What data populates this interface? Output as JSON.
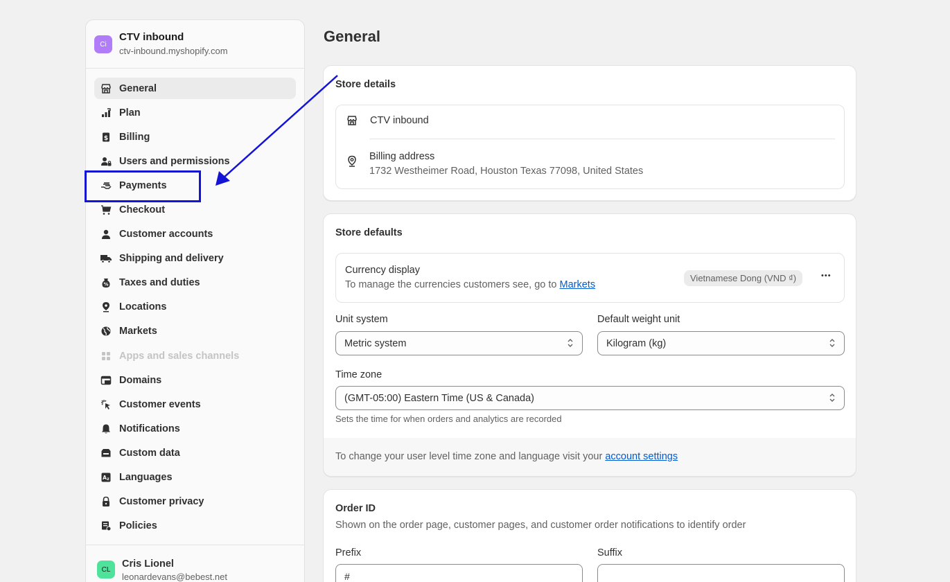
{
  "store": {
    "initials": "Ci",
    "name": "CTV inbound",
    "domain": "ctv-inbound.myshopify.com"
  },
  "nav": {
    "items": [
      {
        "label": "General",
        "icon": "store-icon",
        "active": true
      },
      {
        "label": "Plan",
        "icon": "plan-icon"
      },
      {
        "label": "Billing",
        "icon": "billing-icon"
      },
      {
        "label": "Users and permissions",
        "icon": "users-icon"
      },
      {
        "label": "Payments",
        "icon": "payments-icon"
      },
      {
        "label": "Checkout",
        "icon": "cart-icon"
      },
      {
        "label": "Customer accounts",
        "icon": "person-icon"
      },
      {
        "label": "Shipping and delivery",
        "icon": "truck-icon"
      },
      {
        "label": "Taxes and duties",
        "icon": "tax-icon"
      },
      {
        "label": "Locations",
        "icon": "location-icon"
      },
      {
        "label": "Markets",
        "icon": "globe-icon"
      },
      {
        "label": "Apps and sales channels",
        "icon": "apps-icon",
        "disabled": true
      },
      {
        "label": "Domains",
        "icon": "domains-icon"
      },
      {
        "label": "Customer events",
        "icon": "cursor-icon"
      },
      {
        "label": "Notifications",
        "icon": "bell-icon"
      },
      {
        "label": "Custom data",
        "icon": "custom-data-icon"
      },
      {
        "label": "Languages",
        "icon": "languages-icon"
      },
      {
        "label": "Customer privacy",
        "icon": "lock-icon"
      },
      {
        "label": "Policies",
        "icon": "policies-icon"
      }
    ]
  },
  "user": {
    "initials": "CL",
    "name": "Cris Lionel",
    "email": "leonardevans@bebest.net"
  },
  "page": {
    "title": "General"
  },
  "store_details": {
    "title": "Store details",
    "store_name": "CTV inbound",
    "billing_label": "Billing address",
    "billing_address": "1732 Westheimer Road, Houston Texas 77098, United States"
  },
  "store_defaults": {
    "title": "Store defaults",
    "currency_label": "Currency display",
    "currency_help_prefix": "To manage the currencies customers see, go to ",
    "currency_help_link": "Markets",
    "currency_badge": "Vietnamese Dong (VND ₫)",
    "more_glyph": "•••",
    "unit_system_label": "Unit system",
    "unit_system_value": "Metric system",
    "weight_unit_label": "Default weight unit",
    "weight_unit_value": "Kilogram (kg)",
    "timezone_label": "Time zone",
    "timezone_value": "(GMT-05:00) Eastern Time (US & Canada)",
    "timezone_help": "Sets the time for when orders and analytics are recorded",
    "footer_prefix": "To change your user level time zone and language visit your ",
    "footer_link": "account settings"
  },
  "order_id": {
    "title": "Order ID",
    "help": "Shown on the order page, customer pages, and customer order notifications to identify order",
    "prefix_label": "Prefix",
    "prefix_value": "#",
    "suffix_label": "Suffix",
    "suffix_value": ""
  },
  "colors": {
    "annotation": "#1414d4",
    "link": "#005bd3",
    "store_avatar": "#b07cf7",
    "user_avatar": "#4ee29b"
  }
}
